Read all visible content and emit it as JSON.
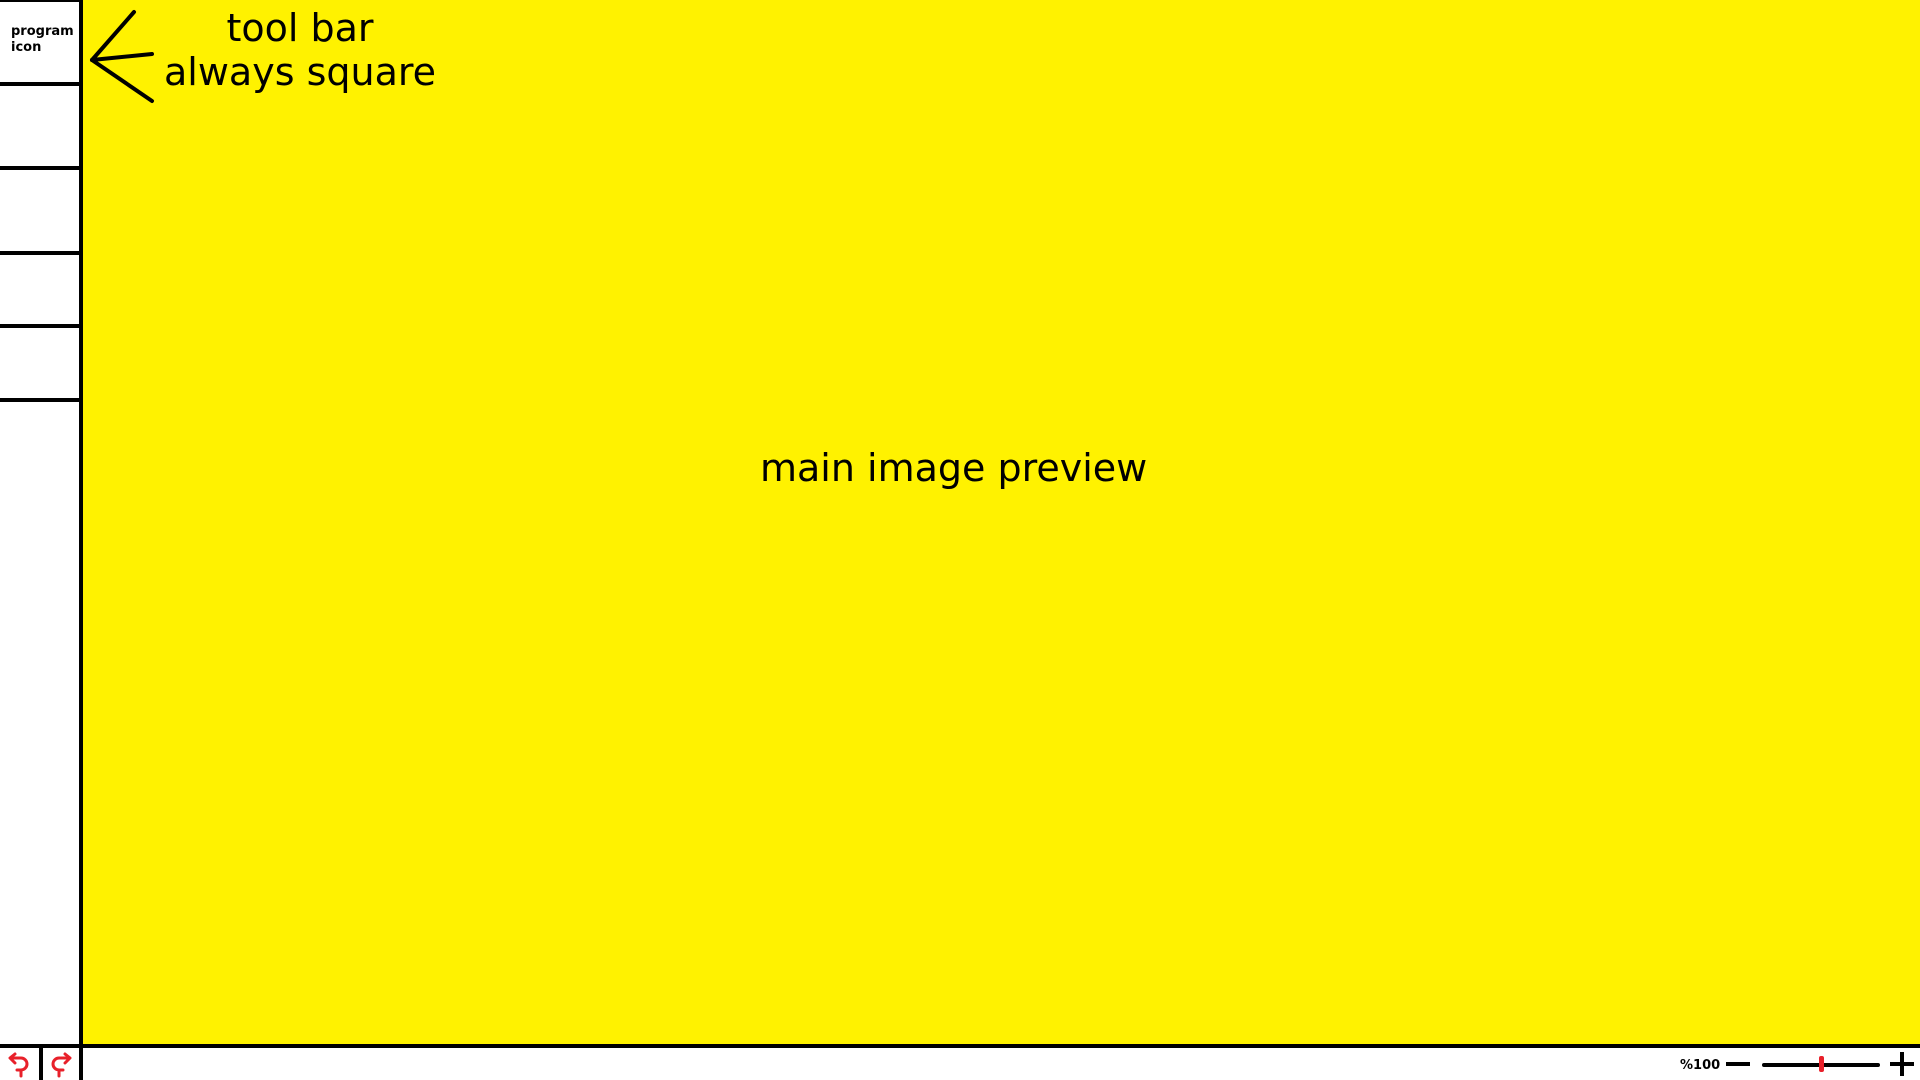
{
  "toolbar": {
    "program_icon_label": "program icon",
    "slots": [
      "",
      "",
      "",
      ""
    ]
  },
  "annotation": {
    "line1": "tool bar",
    "line2": "always square"
  },
  "preview": {
    "label": "main image preview",
    "background_color": "#fff200"
  },
  "statusbar": {
    "undo_icon": "undo-arrow-icon",
    "redo_icon": "redo-arrow-icon",
    "history_icon_color": "#e8202a",
    "zoom_label": "%100",
    "zoom_slider_value": 0.5,
    "zoom_out_icon": "minus-icon",
    "zoom_in_icon": "plus-icon"
  }
}
